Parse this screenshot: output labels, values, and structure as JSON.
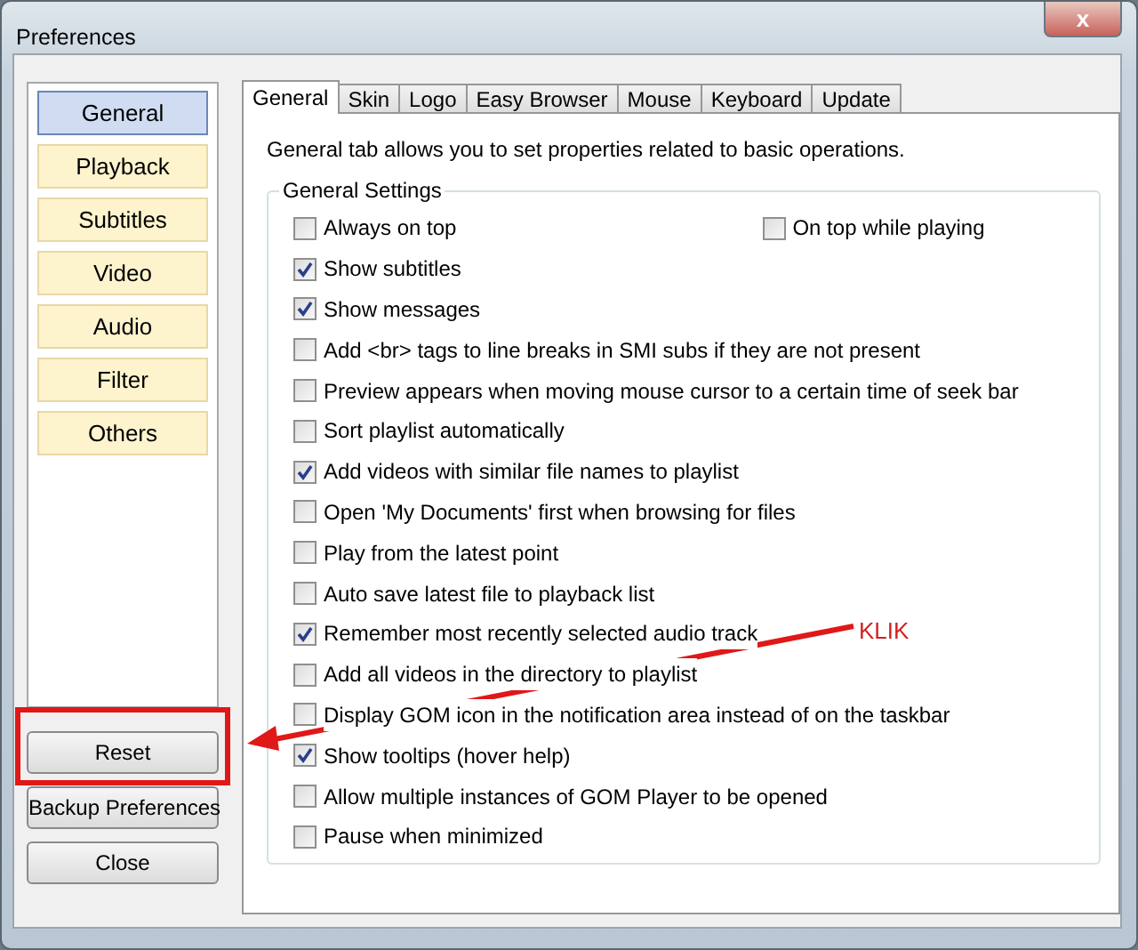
{
  "window": {
    "title": "Preferences",
    "close": "x"
  },
  "categories": [
    {
      "label": "General",
      "selected": true
    },
    {
      "label": "Playback",
      "selected": false
    },
    {
      "label": "Subtitles",
      "selected": false
    },
    {
      "label": "Video",
      "selected": false
    },
    {
      "label": "Audio",
      "selected": false
    },
    {
      "label": "Filter",
      "selected": false
    },
    {
      "label": "Others",
      "selected": false
    }
  ],
  "side_buttons": [
    "Reset",
    "Backup Preferences",
    "Close"
  ],
  "tabs": [
    {
      "label": "General",
      "selected": true
    },
    {
      "label": "Skin",
      "selected": false
    },
    {
      "label": "Logo",
      "selected": false
    },
    {
      "label": "Easy Browser",
      "selected": false
    },
    {
      "label": "Mouse",
      "selected": false
    },
    {
      "label": "Keyboard",
      "selected": false
    },
    {
      "label": "Update",
      "selected": false
    }
  ],
  "description": "General tab allows you to set properties related to basic operations.",
  "group": {
    "title": "General Settings",
    "rows": [
      [
        {
          "label": "Always on top",
          "checked": false
        },
        {
          "label": "On top while playing",
          "checked": false
        }
      ],
      [
        {
          "label": "Show subtitles",
          "checked": true
        }
      ],
      [
        {
          "label": "Show messages",
          "checked": true
        }
      ],
      [
        {
          "label": "Add <br> tags to line breaks in SMI subs if they are not present",
          "checked": false
        }
      ],
      [
        {
          "label": "Preview appears when moving mouse cursor to a certain time of seek bar",
          "checked": false
        }
      ],
      [
        {
          "label": "Sort playlist automatically",
          "checked": false
        }
      ],
      [
        {
          "label": "Add videos with similar file names to playlist",
          "checked": true
        }
      ],
      [
        {
          "label": "Open 'My Documents' first when browsing for files",
          "checked": false
        }
      ],
      [
        {
          "label": "Play from the latest point",
          "checked": false
        }
      ],
      [
        {
          "label": "Auto save latest file to playback list",
          "checked": false
        }
      ],
      [
        {
          "label": "Remember most recently selected audio track",
          "checked": true
        }
      ],
      [
        {
          "label": "Add all videos in the directory to playlist",
          "checked": false
        }
      ],
      [
        {
          "label": "Display GOM icon in the notification area instead of on the taskbar",
          "checked": false
        }
      ],
      [
        {
          "label": "Show tooltips (hover help)",
          "checked": true
        }
      ],
      [
        {
          "label": "Allow multiple instances of GOM Player to be opened",
          "checked": false
        }
      ],
      [
        {
          "label": "Pause when minimized",
          "checked": false
        }
      ]
    ]
  },
  "annotation": {
    "label": "KLIK"
  }
}
